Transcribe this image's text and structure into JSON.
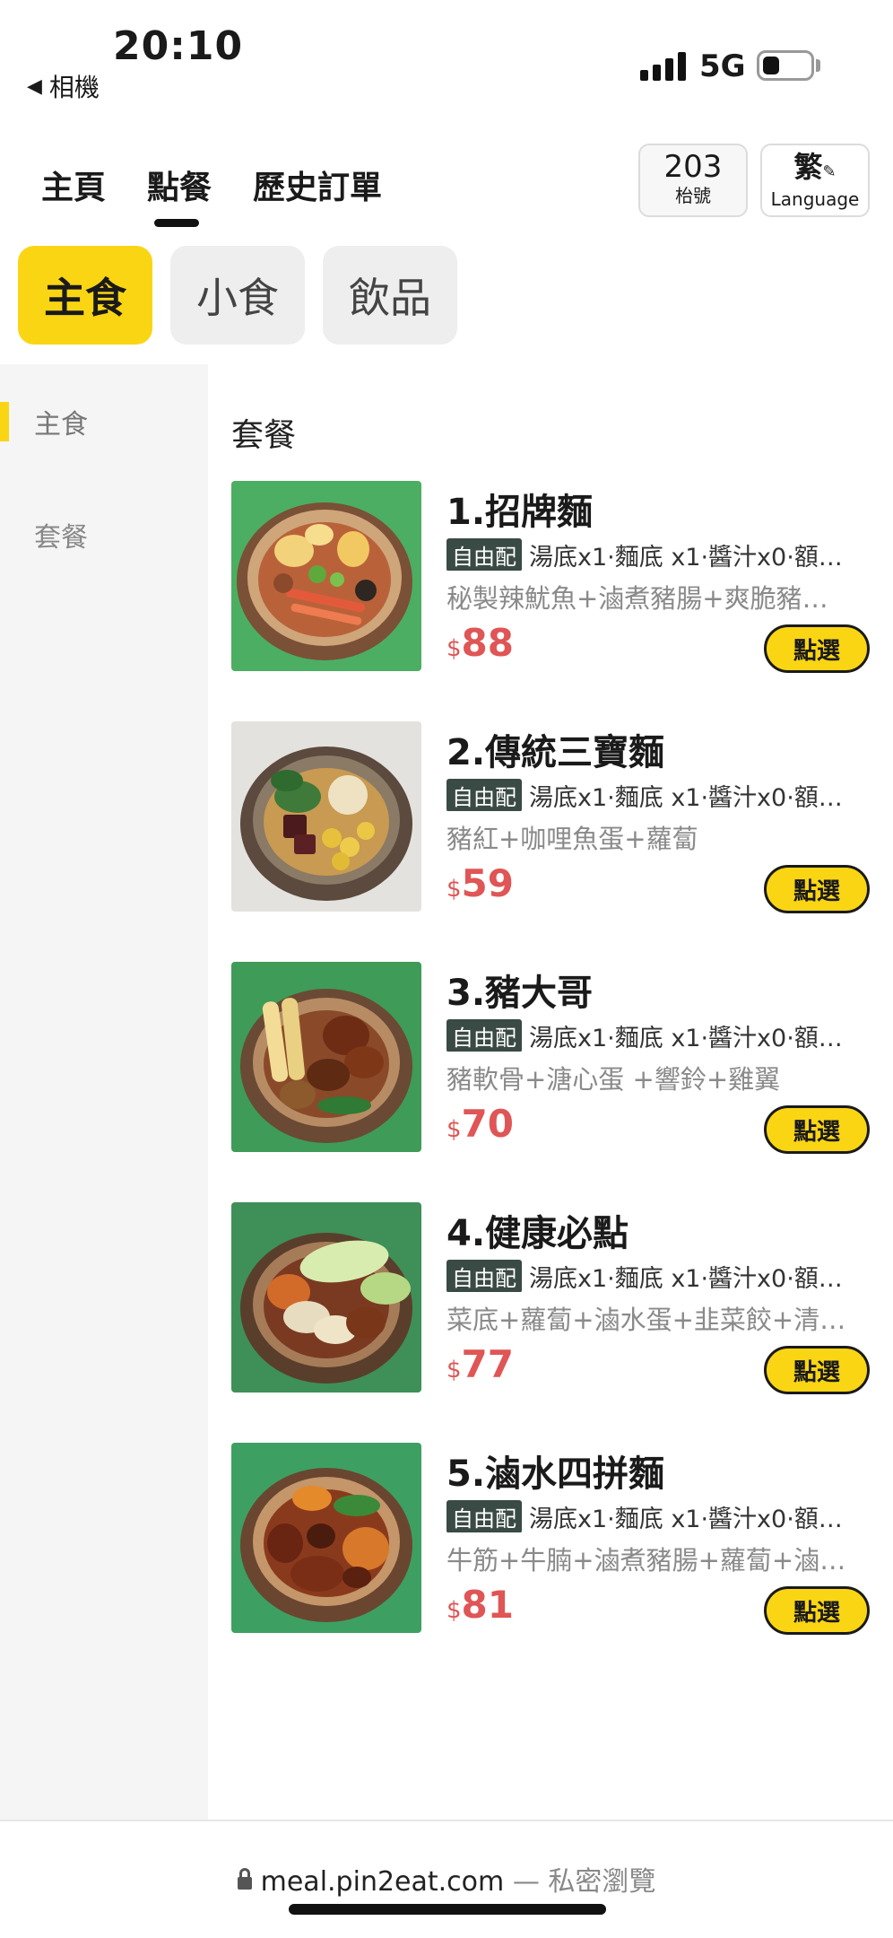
{
  "status_bar": {
    "time": "20:10",
    "back_label": "相機",
    "network": "5G"
  },
  "nav": {
    "tabs": [
      {
        "label": "主頁"
      },
      {
        "label": "點餐"
      },
      {
        "label": "歷史訂單"
      }
    ],
    "active_tab": "點餐",
    "table": {
      "number": "203",
      "label": "枱號"
    },
    "language": {
      "char": "繁",
      "label": "Language"
    }
  },
  "categories": [
    {
      "label": "主食",
      "active": true
    },
    {
      "label": "小食",
      "active": false
    },
    {
      "label": "飲品",
      "active": false
    }
  ],
  "sidebar": {
    "items": [
      {
        "label": "主食",
        "active": true
      },
      {
        "label": "套餐",
        "active": false
      }
    ]
  },
  "section_title": "套餐",
  "items": [
    {
      "name": "1.招牌麵",
      "tag": "自由配",
      "config": "湯底x1·麵底 x1·醬汁x0·額…",
      "desc": "秘製辣魷魚+滷煮豬腸+爽脆豬…",
      "currency": "$",
      "price": "88",
      "button": "點選"
    },
    {
      "name": "2.傳統三寶麵",
      "tag": "自由配",
      "config": "湯底x1·麵底 x1·醬汁x0·額…",
      "desc": "豬紅+咖哩魚蛋+蘿蔔",
      "currency": "$",
      "price": "59",
      "button": "點選"
    },
    {
      "name": "3.豬大哥",
      "tag": "自由配",
      "config": "湯底x1·麵底 x1·醬汁x0·額…",
      "desc": "豬軟骨+溏心蛋 +響鈴+雞翼",
      "currency": "$",
      "price": "70",
      "button": "點選"
    },
    {
      "name": "4.健康必點",
      "tag": "自由配",
      "config": "湯底x1·麵底 x1·醬汁x0·額…",
      "desc": "菜底+蘿蔔+滷水蛋+韭菜餃+清…",
      "currency": "$",
      "price": "77",
      "button": "點選"
    },
    {
      "name": "5.滷水四拼麵",
      "tag": "自由配",
      "config": "湯底x1·麵底 x1·醬汁x0·額…",
      "desc": "牛筋+牛腩+滷煮豬腸+蘿蔔+滷…",
      "currency": "$",
      "price": "81",
      "button": "點選"
    }
  ],
  "url_bar": {
    "domain": "meal.pin2eat.com",
    "separator": "—",
    "mode": "私密瀏覽"
  },
  "colors": {
    "accent": "#fad514",
    "price": "#e05555",
    "tag_bg": "#3a4a44"
  }
}
